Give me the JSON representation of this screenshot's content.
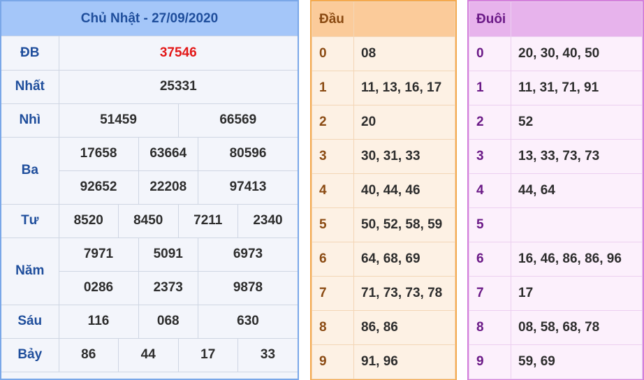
{
  "results": {
    "title": "Chủ Nhật - 27/09/2020",
    "prizes": {
      "db": {
        "label": "ĐB",
        "values": [
          "37546"
        ]
      },
      "nhat": {
        "label": "Nhất",
        "values": [
          "25331"
        ]
      },
      "nhi": {
        "label": "Nhì",
        "values": [
          "51459",
          "66569"
        ]
      },
      "ba": {
        "label": "Ba",
        "values": [
          "17658",
          "63664",
          "80596",
          "92652",
          "22208",
          "97413"
        ]
      },
      "tu": {
        "label": "Tư",
        "values": [
          "8520",
          "8450",
          "7211",
          "2340"
        ]
      },
      "nam": {
        "label": "Năm",
        "values": [
          "7971",
          "5091",
          "6973",
          "0286",
          "2373",
          "9878"
        ]
      },
      "sau": {
        "label": "Sáu",
        "values": [
          "116",
          "068",
          "630"
        ]
      },
      "bay": {
        "label": "Bảy",
        "values": [
          "86",
          "44",
          "17",
          "33"
        ]
      }
    }
  },
  "head": {
    "header": "Đầu",
    "rows": [
      {
        "key": "0",
        "value": "08"
      },
      {
        "key": "1",
        "value": "11, 13, 16, 17"
      },
      {
        "key": "2",
        "value": "20"
      },
      {
        "key": "3",
        "value": "30, 31, 33"
      },
      {
        "key": "4",
        "value": "40, 44, 46"
      },
      {
        "key": "5",
        "value": "50, 52, 58, 59"
      },
      {
        "key": "6",
        "value": "64, 68, 69"
      },
      {
        "key": "7",
        "value": "71, 73, 73, 78"
      },
      {
        "key": "8",
        "value": "86, 86"
      },
      {
        "key": "9",
        "value": "91, 96"
      }
    ]
  },
  "tail": {
    "header": "Đuôi",
    "rows": [
      {
        "key": "0",
        "value": "20, 30, 40, 50"
      },
      {
        "key": "1",
        "value": "11, 31, 71, 91"
      },
      {
        "key": "2",
        "value": "52"
      },
      {
        "key": "3",
        "value": "13, 33, 73, 73"
      },
      {
        "key": "4",
        "value": "44, 64"
      },
      {
        "key": "5",
        "value": ""
      },
      {
        "key": "6",
        "value": "16, 46, 86, 86, 96"
      },
      {
        "key": "7",
        "value": "17"
      },
      {
        "key": "8",
        "value": "08, 58, 68, 78"
      },
      {
        "key": "9",
        "value": "59, 69"
      }
    ]
  }
}
